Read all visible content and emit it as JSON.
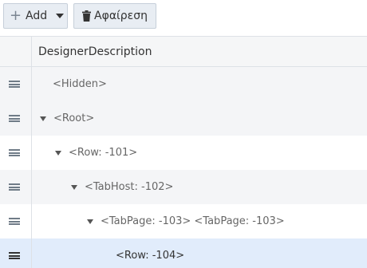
{
  "toolbar": {
    "add_label": "Add",
    "remove_label": "Αφαίρεση"
  },
  "grid": {
    "column_header": "DesignerDescription",
    "rows": [
      {
        "text": "<Hidden>"
      },
      {
        "text": "<Root>",
        "expanded": true
      },
      {
        "text": "<Row: -101>",
        "expanded": true
      },
      {
        "text": "<TabHost: -102>",
        "expanded": true
      },
      {
        "text": "<TabPage: -103> <TabPage: -103>",
        "expanded": true
      },
      {
        "text": "<Row: -104>",
        "selected": true
      }
    ]
  },
  "colors": {
    "button_bg": "#e8edf3",
    "selected_row": "#e1ecfb",
    "alt_row": "#f4f5f7"
  }
}
